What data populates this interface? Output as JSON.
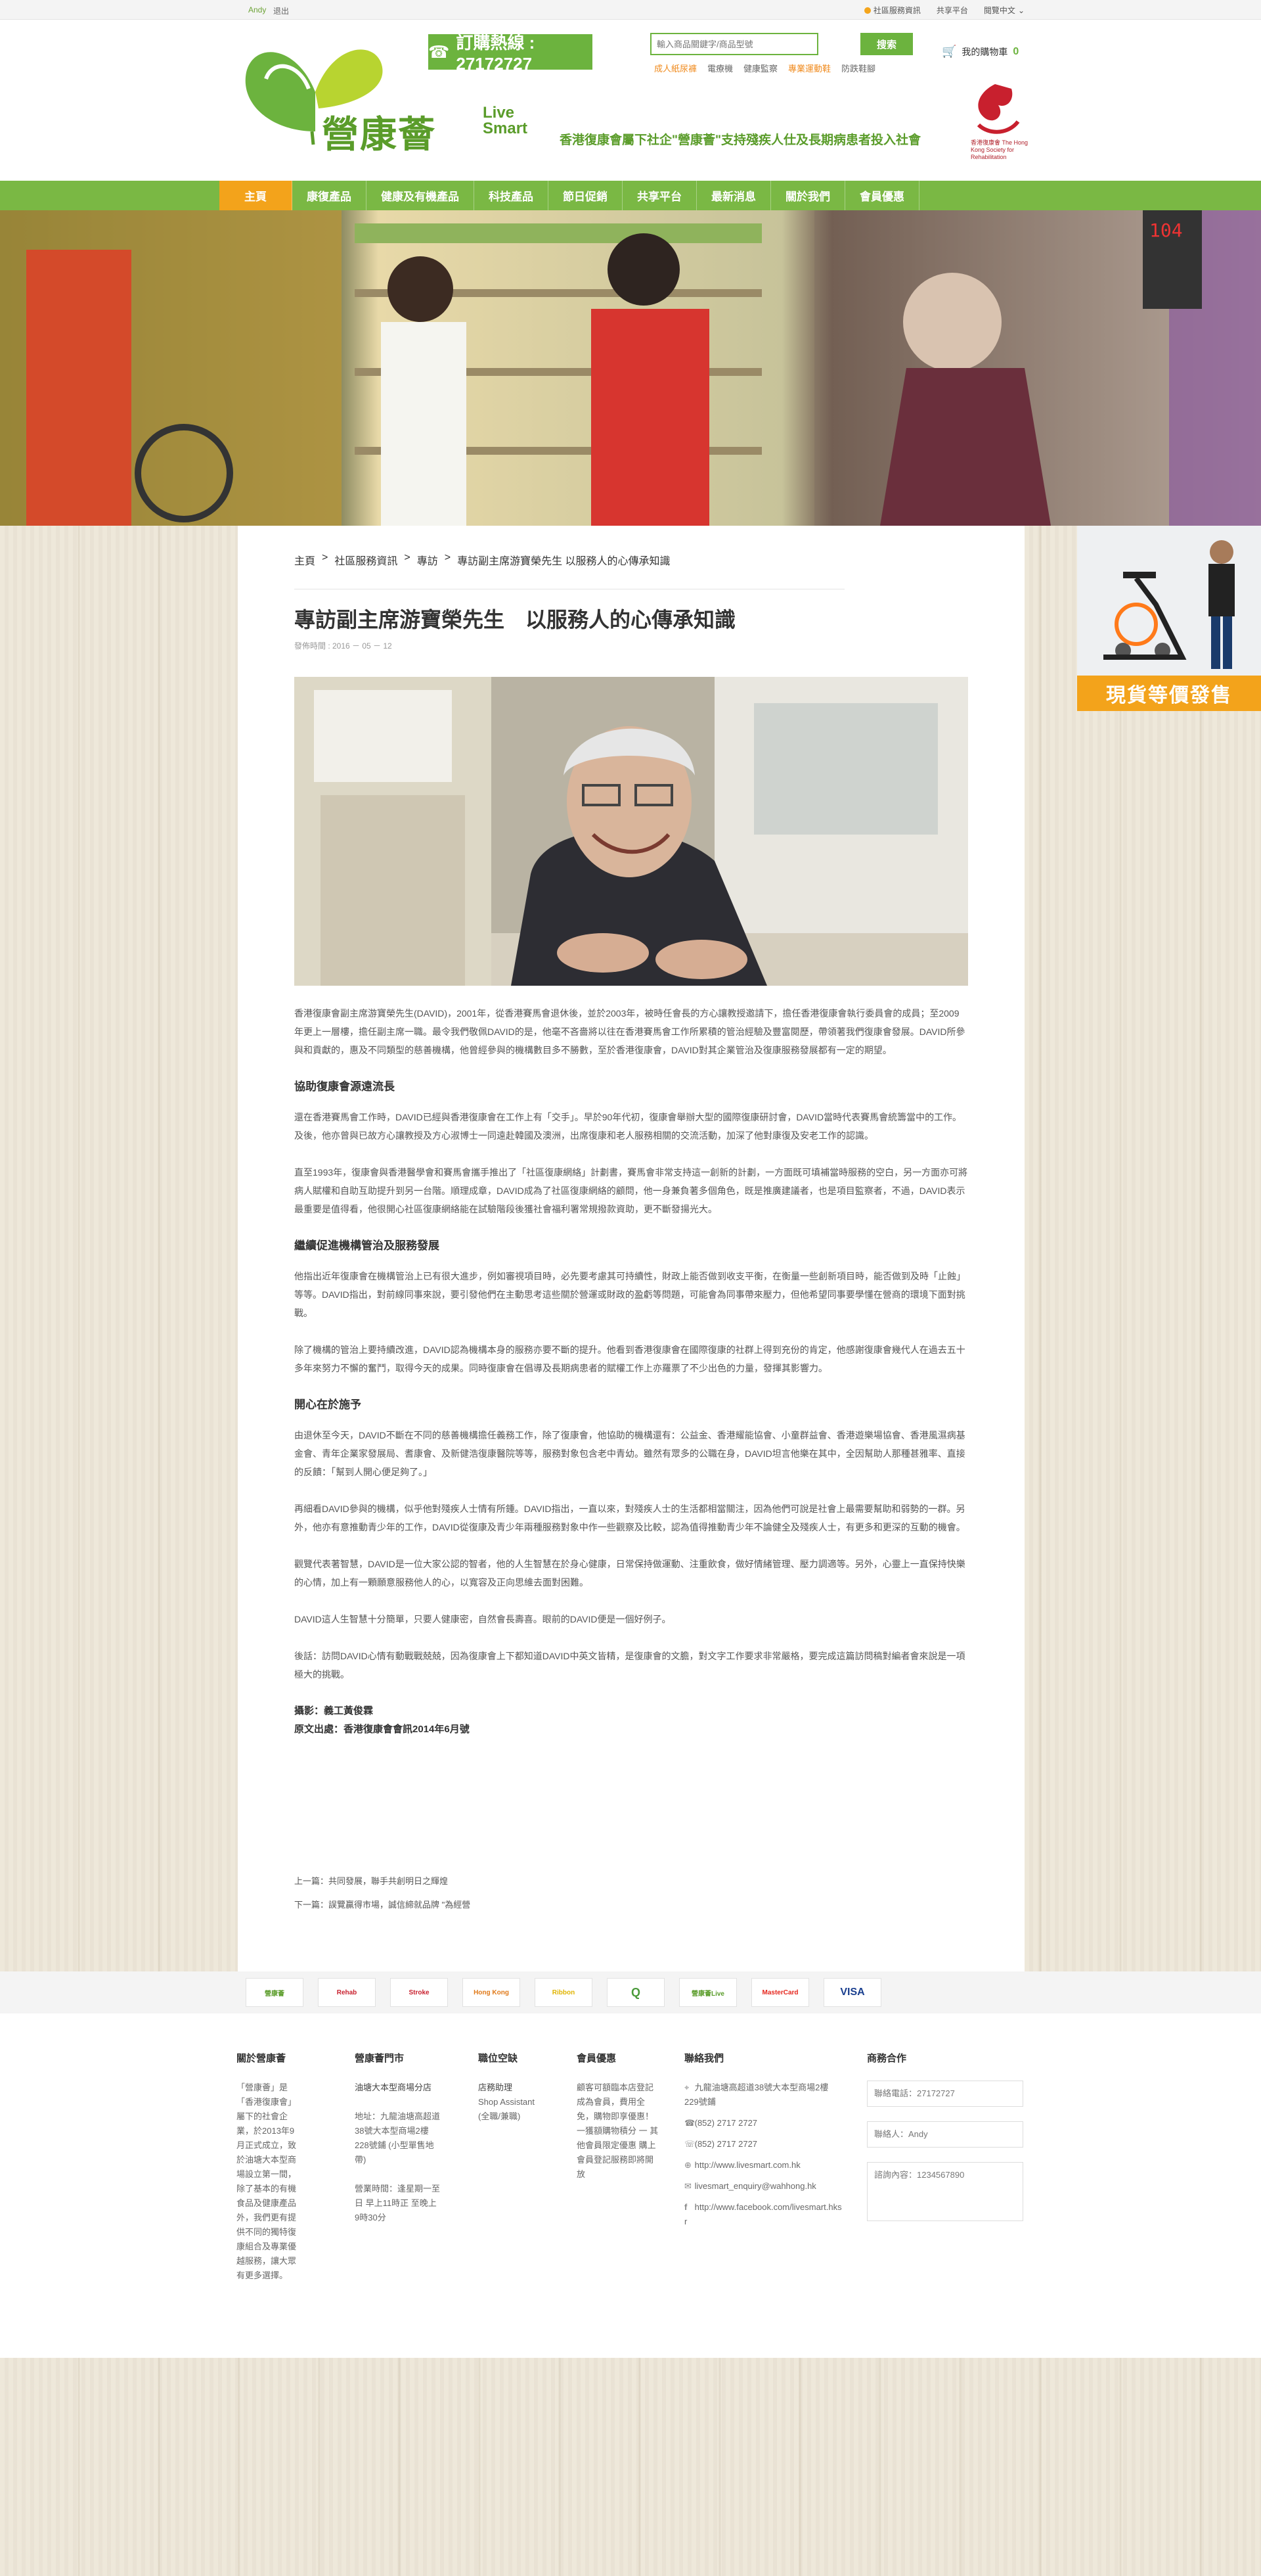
{
  "topbar": {
    "user": "Andy",
    "logout": "退出",
    "links": [
      "社區服務資訊",
      "共享平台",
      "閱覽中文"
    ]
  },
  "header": {
    "logo_text": "營康薈",
    "logo_en_1": "Live",
    "logo_en_2": "Smart",
    "hotline": "訂購熱線 : 27172727",
    "search_placeholder": "輸入商品關鍵字/商品型號",
    "search_button": "搜索",
    "search_links": [
      "成人紙尿褲",
      "電療機",
      "健康監察",
      "專業運動鞋",
      "防跌鞋腳"
    ],
    "cart_label": "我的購物車",
    "cart_count": "0",
    "tagline": "香港復康會屬下社企\"營康薈\"支持殘疾人仕及長期病患者投入社會",
    "hkrehab_caption": "香港復康會 The Hong Kong Society for Rehabilitation"
  },
  "nav": [
    "主頁",
    "康復產品",
    "健康及有機產品",
    "科技產品",
    "節日促銷",
    "共享平台",
    "最新消息",
    "關於我們",
    "會員優惠"
  ],
  "breadcrumb": [
    "主頁",
    "社區服務資訊",
    "專訪",
    "專訪副主席游寶榮先生 以服務人的心傳承知識"
  ],
  "article": {
    "title": "專訪副主席游寶榮先生　以服務人的心傳承知識",
    "date": "發佈時間 : 2016 － 05 － 12",
    "p1": "香港復康會副主席游寶榮先生(DAVID)，2001年，從香港賽馬會退休後，並於2003年，被時任會長的方心讓教授邀請下，擔任香港復康會執行委員會的成員；至2009年更上一層樓，擔任副主席一職。最令我們敬佩DAVID的是，他毫不吝嗇將以往在香港賽馬會工作所累積的管治經驗及豐富閱歷，帶領著我們復康會發展。DAVID所參與和貢獻的，惠及不同類型的慈善機構，他曾經參與的機構數目多不勝數，至於香港復康會，DAVID對其企業管治及復康服務發展都有一定的期望。",
    "h1": "協助復康會源遠流長",
    "p2": "還在香港賽馬會工作時，DAVID已經與香港復康會在工作上有「交手」。早於90年代初，復康會舉辦大型的國際復康研討會，DAVID當時代表賽馬會統籌當中的工作。及後，他亦曾與已故方心讓教授及方心淑博士一同遠赴韓國及澳洲，出席復康和老人服務相關的交流活動，加深了他對康復及安老工作的認識。",
    "p3": "直至1993年，復康會與香港醫學會和賽馬會攜手推出了「社區復康網絡」計劃書，賽馬會非常支持這一創新的計劃，一方面既可填補當時服務的空白，另一方面亦可將病人賦權和自助互助提升到另一台階。順理成章，DAVID成為了社區復康網絡的顧問，他一身兼負著多個角色，既是推廣建議者，也是項目監察者，不過，DAVID表示最重要是值得看，他很開心社區復康網絡能在試驗階段後獲社會福利署常規撥款資助，更不斷發揚光大。",
    "h2": "繼續促進機構管治及服務發展",
    "p4": "他指出近年復康會在機構管治上已有很大進步，例如審視項目時，必先要考慮其可持續性，財政上能否做到收支平衡，在衡量一些創新項目時，能否做到及時「止蝕」等等。DAVID指出，對前線同事來說，要引發他們在主動思考這些關於營運或財政的盈虧等問題，可能會為同事帶來壓力，但他希望同事要學懂在營商的環境下面對挑戰。",
    "p5": "除了機構的管治上要持續改進，DAVID認為機構本身的服務亦要不斷的提升。他看到香港復康會在國際復康的社群上得到充份的肯定，他感謝復康會幾代人在過去五十多年來努力不懈的奮鬥，取得今天的成果。同時復康會在倡導及長期病患者的賦權工作上亦羅票了不少出色的力量，發揮其影響力。",
    "h3": "開心在於施予",
    "p6": "由退休至今天，DAVID不斷在不同的慈善機構擔任義務工作，除了復康會，他協助的機構還有：公益金、香港耀能協會、小童群益會、香港遊樂場協會、香港風濕病基金會、青年企業家發展局、耆康會、及新健浩復康醫院等等，服務對象包含老中青幼。雖然有眾多的公職在身，DAVID坦言他樂在其中，全因幫助人那種甚雅率、直接的反饋：「幫到人開心便足夠了。」",
    "p7": "再細看DAVID參與的機構，似乎他對殘疾人士情有所鍾。DAVID指出，一直以來，對殘疾人士的生活都相當關注，因為他們可說是社會上最需要幫助和弱勢的一群。另外，他亦有意推動青少年的工作，DAVID從復康及青少年兩種服務對象中作一些觀察及比較，認為值得推動青少年不論健全及殘疾人士，有更多和更深的互動的機會。",
    "p8": "觀覽代表著智慧，DAVID是一位大家公認的智者，他的人生智慧在於身心健康，日常保持做運動、注重飲食，做好情緒管理、壓力調適等。另外，心靈上一直保持快樂的心情，加上有一顆願意服務他人的心，以寬容及正向思維去面對困難。",
    "p9": "DAVID這人生智慧十分簡單，只要人健康密，自然會長壽喜。眼前的DAVID便是一個好例子。",
    "p10": "後話：訪問DAVID心情有動戰戰兢兢，因為復康會上下都知道DAVID中英文皆精，是復康會的文膽，對文字工作要求非常嚴格，要完成這篇訪問稿對編者會來說是一項極大的挑戰。",
    "credit_1": "攝影：義工黃俊霖",
    "credit_2": "原文出處：香港復康會會訊2014年6月號",
    "prev": "上一篇：共同發展，聯手共創明日之輝煌",
    "next": "下一篇：誤覽贏得市場，誠信締就品牌 \"為經營"
  },
  "sidead": {
    "banner": "現貨等價發售"
  },
  "partners": [
    "營康薈",
    "Rehab",
    "Stroke",
    "Hong Kong",
    "Ribbon",
    "Q",
    "營康薈Live",
    "MasterCard",
    "VISA"
  ],
  "footer": {
    "about": {
      "title": "關於營康薈",
      "text": "「營康薈」是「香港復康會」屬下的社會企業，於2013年9月正式成立，致於油塘大本型商場設立第一間，除了基本的有機食品及健康產品外，我們更有提供不同的獨特復康組合及專業優越服務，讓大眾有更多選擇。"
    },
    "store": {
      "title": "營康薈門市",
      "name": "油塘大本型商場分店",
      "address": "地址：九龍油塘高超道38號大本型商場2樓228號鋪 (小型單售地帶)",
      "hours": "營業時間：逢星期一至日 早上11時正 至晚上 9時30分"
    },
    "jobs": {
      "title": "職位空缺",
      "items": [
        "店務助理",
        "Shop Assistant",
        "(全職/兼職)"
      ]
    },
    "member": {
      "title": "會員優惠",
      "text": "顧客可額臨本店登記成為會員，費用全免，購物即享優惠！ 一獲額購物積分 一 其他會員限定優惠 購上會員登記服務即將開放"
    },
    "contact": {
      "title": "聯絡我們",
      "address": "九龍油塘高超道38號大本型商場2樓229號鋪",
      "phone": "(852) 2717 2727",
      "fax": "(852) 2717 2727",
      "website": "http://www.livesmart.com.hk",
      "email": "livesmart_enquiry@wahhong.hk",
      "facebook": "http://www.facebook.com/livesmart.hksr"
    },
    "business": {
      "title": "商務合作",
      "phone": "聯絡電話：27172727",
      "contact": "聯絡人：Andy",
      "message": "諮詢內容：1234567890"
    }
  },
  "colors": {
    "green": "#7ab844",
    "orange": "#f3a31b",
    "logo_green": "#5a9c2a"
  }
}
